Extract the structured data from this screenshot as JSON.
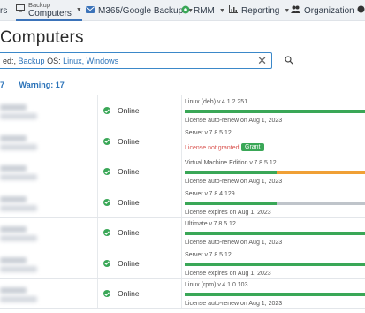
{
  "nav": {
    "item0": "rs",
    "backup_top": "Backup",
    "backup_bottom": "Computers",
    "m365": "M365/Google Backup",
    "rmm": "RMM",
    "reporting": "Reporting",
    "organization": "Organization"
  },
  "page": {
    "title": "Computers"
  },
  "search": {
    "prefix": "ed:,",
    "backup": "Backup",
    "os_label": "OS:",
    "os_value": "Linux, Windows"
  },
  "summary": {
    "count": "7",
    "warning_label": "Warning:",
    "warning_count": "17"
  },
  "colors": {
    "online": "#3aa757",
    "bar_green": "#3aa757",
    "bar_orange": "#f0a035",
    "bar_gray": "#bfc4ca",
    "accent": "#2a72b8"
  },
  "rows": [
    {
      "status": "Online",
      "version": "Linux (deb) v.4.1.2.251",
      "license": "License auto-renew on Aug 1, 2023",
      "bar": {
        "green": 1.0,
        "orange": 0,
        "gray": 0
      }
    },
    {
      "status": "Online",
      "version": "Server v.7.8.5.12",
      "license": "License not granted",
      "grant": "Grant",
      "bar": null
    },
    {
      "status": "Online",
      "version": "Virtual Machine Edition v.7.8.5.12",
      "license": "License auto-renew on Aug 1, 2023",
      "bar": {
        "green": 0.51,
        "orange": 0.49,
        "gray": 0
      }
    },
    {
      "status": "Online",
      "version": "Server v.7.8.4.129",
      "license": "License expires on Aug 1, 2023",
      "bar": {
        "green": 0.51,
        "orange": 0,
        "gray": 0.49
      }
    },
    {
      "status": "Online",
      "version": "Ultimate v.7.8.5.12",
      "license": "License auto-renew on Aug 1, 2023",
      "bar": {
        "green": 1.0,
        "orange": 0,
        "gray": 0
      }
    },
    {
      "status": "Online",
      "version": "Server v.7.8.5.12",
      "license": "License expires on Aug 1, 2023",
      "bar": {
        "green": 1.0,
        "orange": 0,
        "gray": 0
      }
    },
    {
      "status": "Online",
      "version": "Linux (rpm) v.4.1.0.103",
      "license": "License auto-renew on Aug 1, 2023",
      "bar": {
        "green": 1.0,
        "orange": 0,
        "gray": 0
      }
    }
  ]
}
